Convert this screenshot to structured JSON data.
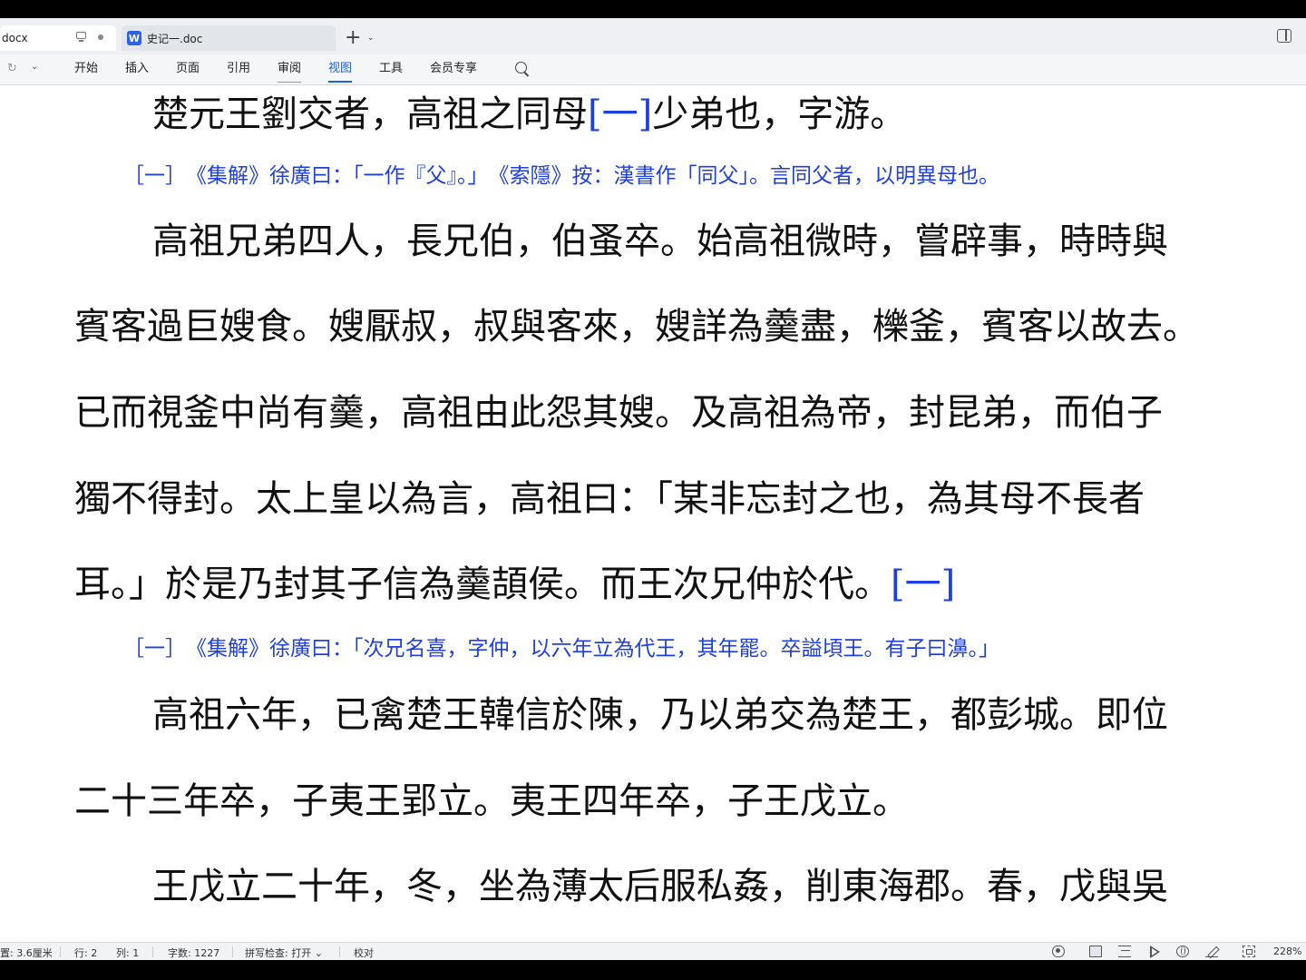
{
  "tabs": [
    {
      "label": "docx"
    },
    {
      "label": "史记一.doc",
      "app_badge": "W"
    }
  ],
  "tab_actions": {
    "new_tab": "+",
    "dropdown": "⌄"
  },
  "menu": {
    "redo": "↻",
    "dropdown": "⌄",
    "items": [
      "开始",
      "插入",
      "页面",
      "引用",
      "审阅",
      "视图",
      "工具",
      "会员专享"
    ],
    "active": "视图"
  },
  "document": {
    "text_color": "#111111",
    "note_color": "#1f3fe0",
    "lines": [
      {
        "kind": "body",
        "text": "楚元王劉交者，高祖之同母",
        "ref": "[一]",
        "tail": "少弟也，字游。"
      },
      {
        "kind": "note",
        "text": "［一］　《集解》徐廣曰：「一作『父』。」　《索隱》按：漢書作「同父」。言同父者，以明異母也。"
      },
      {
        "kind": "body",
        "text": "高祖兄弟四人，長兄伯，伯蚤卒。始高祖微時，嘗辟事，時時與"
      },
      {
        "kind": "body",
        "text": "賓客過巨嫂食。嫂厭叔，叔與客來，嫂詳為羹盡，櫟釜，賓客以故去。"
      },
      {
        "kind": "body",
        "text": "已而視釜中尚有羹，高祖由此怨其嫂。及高祖為帝，封昆弟，而伯子"
      },
      {
        "kind": "body",
        "text": "獨不得封。太上皇以為言，高祖曰：「某非忘封之也，為其母不長者"
      },
      {
        "kind": "body",
        "text": "耳。」於是乃封其子信為羹頡侯。而王次兄仲於代。",
        "ref": "[一]",
        "tail": ""
      },
      {
        "kind": "note",
        "text": "［一］　《集解》徐廣曰：「次兄名喜，字仲，以六年立為代王，其年罷。卒謚頃王。有子曰濞。」"
      },
      {
        "kind": "body",
        "text": "高祖六年，已禽楚王韓信於陳，乃以弟交為楚王，都彭城。即位"
      },
      {
        "kind": "body",
        "text": "二十三年卒，子夷王郢立。夷王四年卒，子王戊立。"
      },
      {
        "kind": "body",
        "text": "王戊立二十年，冬，坐為薄太后服私姦，削東海郡。春，戊與吳"
      }
    ]
  },
  "status": {
    "position": "置: 3.6厘米",
    "row": "行: 2",
    "col": "列: 1",
    "word_count": "字数: 1227",
    "spell_check": "拼写检查: 打开 ⌄",
    "proofread": "校对",
    "zoom": "228%",
    "icons": [
      "eye-icon",
      "page-view-icon",
      "outline-icon",
      "play-icon",
      "globe-icon",
      "pen-icon",
      "fit-icon"
    ]
  }
}
